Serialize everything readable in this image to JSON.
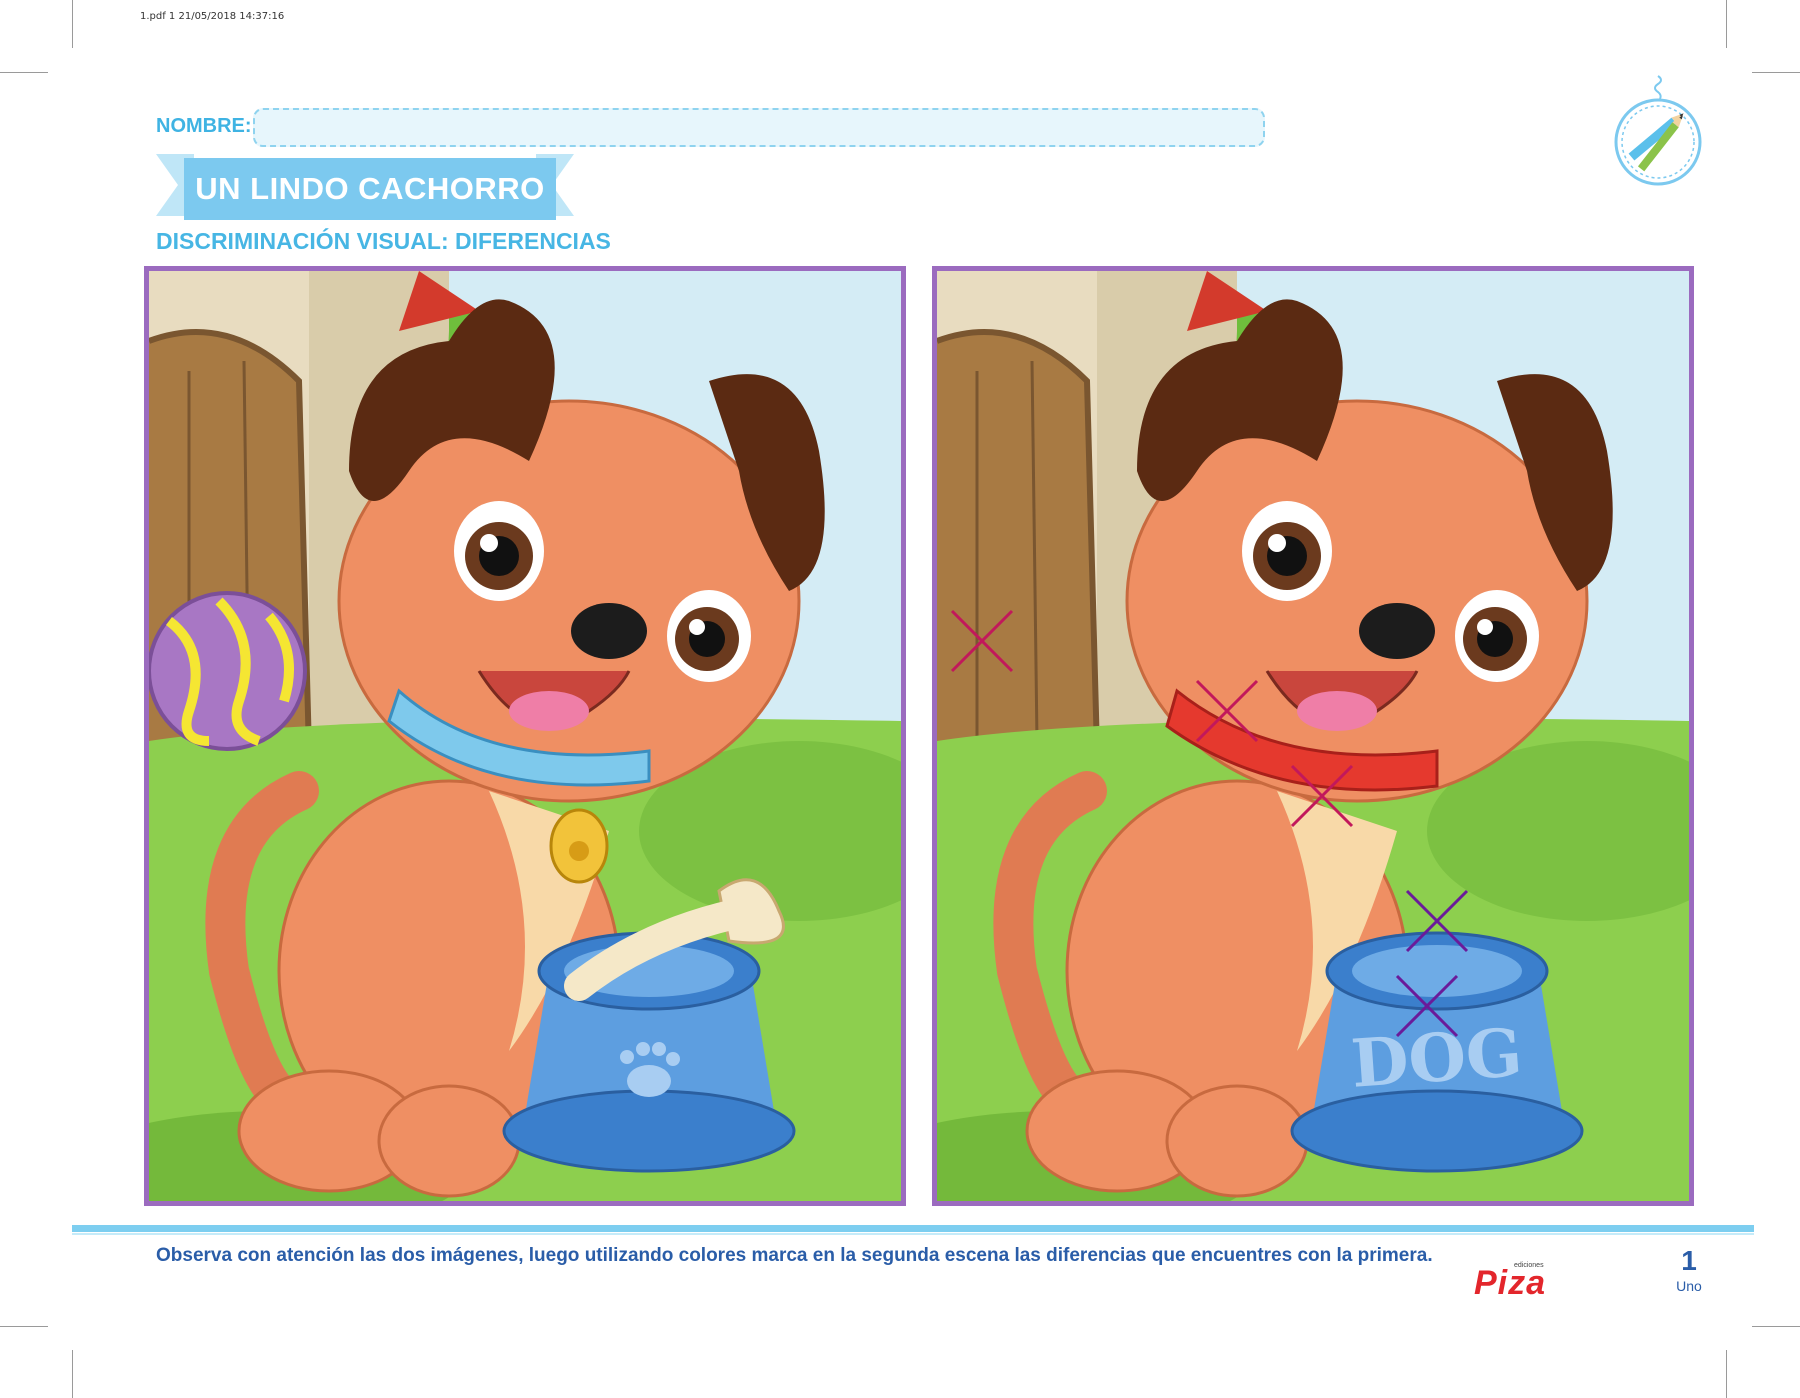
{
  "print_info": "1.pdf   1   21/05/2018   14:37:16",
  "header": {
    "name_label": "NOMBRE:",
    "title": "UN LINDO CACHORRO",
    "subtitle": "DISCRIMINACIÓN VISUAL: DIFERENCIAS"
  },
  "scene_right": {
    "bowl_text": "DOG"
  },
  "colors": {
    "accent_blue": "#7cc9ef",
    "frame_purple": "#9b6bbf",
    "mark_red": "#c2185b",
    "mark_purple": "#6a1b9a"
  },
  "footer": {
    "instructions": "Observa con atención las dos imágenes, luego utilizando colores marca en la segunda escena las diferencias que encuentres con la primera.",
    "publisher_small": "ediciones",
    "publisher_name": "Piza",
    "page_number": "1",
    "page_word": "Uno"
  }
}
